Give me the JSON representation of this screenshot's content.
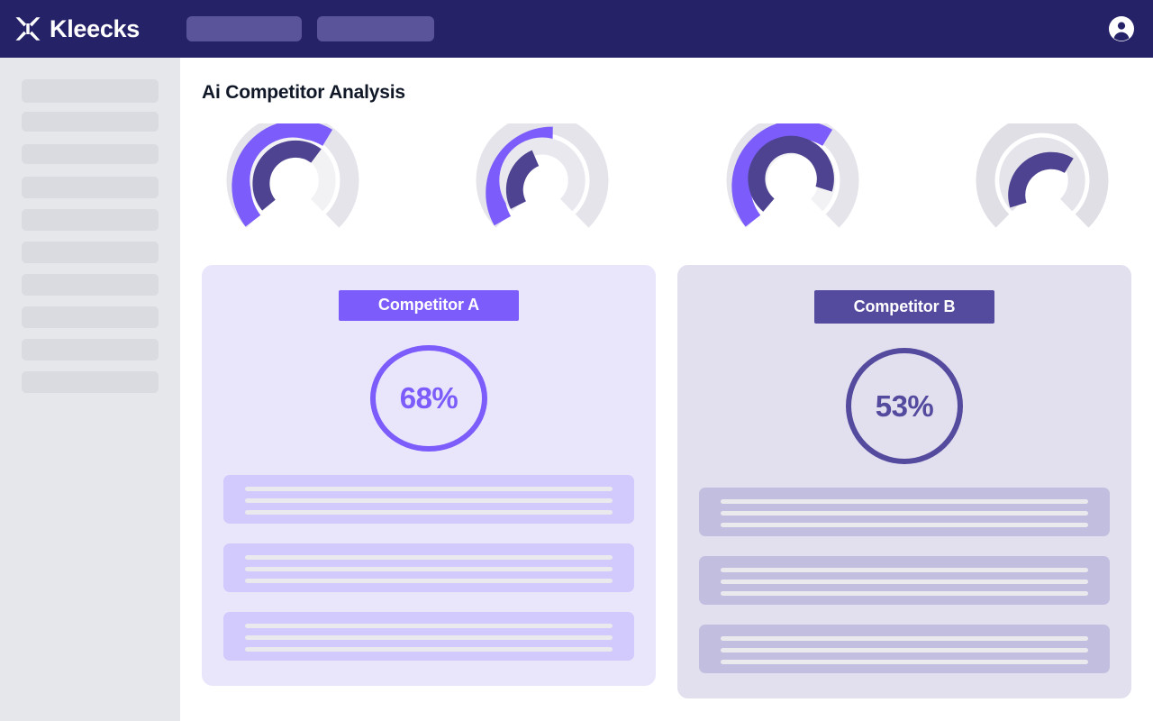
{
  "topbar": {
    "brand_name": "Kleecks",
    "brand_icon": "kleecks-x-logo-icon",
    "account_icon": "user-account-icon",
    "nav_placeholders": [
      {
        "name": "nav-placeholder-1"
      },
      {
        "name": "nav-placeholder-2"
      }
    ]
  },
  "sidebar": {
    "skeleton_items": [
      {
        "height": 26
      },
      {
        "height": 22
      },
      {
        "height": 22
      },
      {
        "height": 24
      },
      {
        "height": 24
      },
      {
        "height": 24
      },
      {
        "height": 24
      },
      {
        "height": 24
      },
      {
        "height": 24
      },
      {
        "height": 24
      }
    ]
  },
  "main": {
    "page_title": "Ai Competitor Analysis"
  },
  "chart_data": [
    {
      "type": "gauge",
      "name": "gauge-1",
      "title": "",
      "series": [
        {
          "name": "outer",
          "value": 78,
          "color": "#7c5cfa",
          "track_color": "#e4e4ea"
        },
        {
          "name": "inner",
          "value": 70,
          "color": "#4e4391",
          "track_color": "#f2f2f5"
        }
      ],
      "ylim": [
        0,
        100
      ],
      "sweep_degrees": 270
    },
    {
      "type": "gauge",
      "name": "gauge-2",
      "title": "",
      "series": [
        {
          "name": "outer",
          "value": 57,
          "color": "#7c5cfa",
          "track_color": "#e4e4ea"
        },
        {
          "name": "inner",
          "value": 41,
          "color": "#4e4391",
          "track_color": "#f2f2f5"
        }
      ],
      "ylim": [
        0,
        100
      ],
      "sweep_degrees": 270
    },
    {
      "type": "gauge",
      "name": "gauge-3",
      "title": "",
      "series": [
        {
          "name": "outer",
          "value": 78,
          "color": "#7c5cfa",
          "track_color": "#e4e4ea"
        },
        {
          "name": "inner",
          "value": 80,
          "color": "#4e4391",
          "track_color": "#f2f2f5"
        }
      ],
      "ylim": [
        0,
        100
      ],
      "sweep_degrees": 270
    },
    {
      "type": "gauge",
      "name": "gauge-4",
      "title": "",
      "series": [
        {
          "name": "outer",
          "value": 0,
          "color": "#7c5cfa",
          "track_color": "#dfdfe5"
        },
        {
          "name": "inner",
          "value": 62,
          "color": "#4e4391",
          "track_color": "#e4e4ea"
        }
      ],
      "ylim": [
        0,
        100
      ],
      "sweep_degrees": 270
    },
    {
      "type": "gauge",
      "name": "competitor-a-score-ring",
      "title": "Competitor A",
      "values": [
        68
      ],
      "value_label": "68%",
      "color": "#7c5cfa",
      "ylim": [
        0,
        100
      ]
    },
    {
      "type": "gauge",
      "name": "competitor-b-score-ring",
      "title": "Competitor B",
      "values": [
        53
      ],
      "value_label": "53%",
      "color": "#544a9e",
      "ylim": [
        0,
        100
      ]
    }
  ],
  "cards": [
    {
      "id": "competitor-a",
      "chip_label": "Competitor A",
      "score_label": "68%",
      "accent": "#7c5cfa",
      "background": "#e9e6fc",
      "block_background": "#d2c9fc",
      "skeleton_blocks": [
        {
          "lines": 3
        },
        {
          "lines": 3
        },
        {
          "lines": 3
        }
      ]
    },
    {
      "id": "competitor-b",
      "chip_label": "Competitor B",
      "score_label": "53%",
      "accent": "#544a9e",
      "background": "#e2e0ef",
      "block_background": "#c2bedf",
      "skeleton_blocks": [
        {
          "lines": 3
        },
        {
          "lines": 3
        },
        {
          "lines": 3
        }
      ]
    }
  ],
  "colors": {
    "topbar": "#262268",
    "sidebar": "#e5e7ea",
    "accent_light": "#7c5cfa",
    "accent_dark": "#4e4391",
    "page_background": "#ffffff",
    "title_text": "#101828"
  }
}
